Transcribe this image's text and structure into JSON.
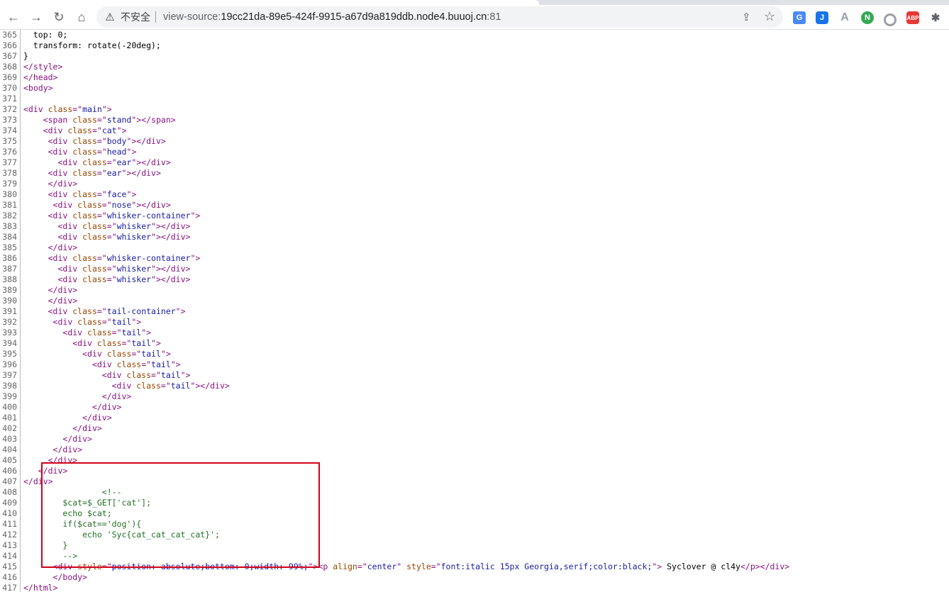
{
  "browser": {
    "security_label": "不安全",
    "url_scheme": "view-source:",
    "url_host": "19cc21da-89e5-424f-9915-a67d9a819ddb.node4.buuoj.cn",
    "url_port": ":81",
    "icons": {
      "back": "arrow-left-icon",
      "forward": "arrow-right-icon",
      "reload": "reload-icon",
      "home": "home-icon",
      "warning": "warning-icon",
      "share": "share-icon",
      "bookmark": "star-icon"
    },
    "extensions": [
      {
        "name": "translate-extension-icon",
        "glyph": "G"
      },
      {
        "name": "j-extension-icon",
        "glyph": "J"
      },
      {
        "name": "a-extension-icon",
        "glyph": "A"
      },
      {
        "name": "n-extension-icon",
        "glyph": "N"
      },
      {
        "name": "circle-extension-icon",
        "glyph": ""
      },
      {
        "name": "abp-extension-icon",
        "glyph": "ABP"
      },
      {
        "name": "puzzle-extension-icon",
        "glyph": "✱"
      }
    ]
  },
  "highlight_color": "#d0021b",
  "source_lines": [
    {
      "n": "365",
      "t": [
        [
          "txt",
          "  top: 0;"
        ]
      ]
    },
    {
      "n": "366",
      "t": [
        [
          "txt",
          "  transform: rotate(-20deg);"
        ]
      ]
    },
    {
      "n": "367",
      "t": [
        [
          "txt",
          "}"
        ]
      ]
    },
    {
      "n": "368",
      "t": [
        [
          "tag",
          "</style>"
        ]
      ]
    },
    {
      "n": "369",
      "t": [
        [
          "tag",
          "</head>"
        ]
      ]
    },
    {
      "n": "370",
      "t": [
        [
          "tag",
          "<body>"
        ]
      ]
    },
    {
      "n": "371",
      "t": []
    },
    {
      "n": "372",
      "t": [
        [
          "tag",
          "<div "
        ],
        [
          "attr",
          "class"
        ],
        [
          "tag",
          "=\""
        ],
        [
          "val",
          "main"
        ],
        [
          "tag",
          "\">"
        ]
      ]
    },
    {
      "n": "373",
      "t": [
        [
          "txt",
          "    "
        ],
        [
          "tag",
          "<span "
        ],
        [
          "attr",
          "class"
        ],
        [
          "tag",
          "=\""
        ],
        [
          "val",
          "stand"
        ],
        [
          "tag",
          "\"></span>"
        ]
      ]
    },
    {
      "n": "374",
      "t": [
        [
          "txt",
          "    "
        ],
        [
          "tag",
          "<div "
        ],
        [
          "attr",
          "class"
        ],
        [
          "tag",
          "=\""
        ],
        [
          "val",
          "cat"
        ],
        [
          "tag",
          "\">"
        ]
      ]
    },
    {
      "n": "375",
      "t": [
        [
          "txt",
          "     "
        ],
        [
          "tag",
          "<div "
        ],
        [
          "attr",
          "class"
        ],
        [
          "tag",
          "=\""
        ],
        [
          "val",
          "body"
        ],
        [
          "tag",
          "\"></div>"
        ]
      ]
    },
    {
      "n": "376",
      "t": [
        [
          "txt",
          "     "
        ],
        [
          "tag",
          "<div "
        ],
        [
          "attr",
          "class"
        ],
        [
          "tag",
          "=\""
        ],
        [
          "val",
          "head"
        ],
        [
          "tag",
          "\">"
        ]
      ]
    },
    {
      "n": "377",
      "t": [
        [
          "txt",
          "       "
        ],
        [
          "tag",
          "<div "
        ],
        [
          "attr",
          "class"
        ],
        [
          "tag",
          "=\""
        ],
        [
          "val",
          "ear"
        ],
        [
          "tag",
          "\"></div>"
        ]
      ]
    },
    {
      "n": "378",
      "t": [
        [
          "txt",
          "     "
        ],
        [
          "tag",
          "<div "
        ],
        [
          "attr",
          "class"
        ],
        [
          "tag",
          "=\""
        ],
        [
          "val",
          "ear"
        ],
        [
          "tag",
          "\"></div>"
        ]
      ]
    },
    {
      "n": "379",
      "t": [
        [
          "txt",
          "     "
        ],
        [
          "tag",
          "</div>"
        ]
      ]
    },
    {
      "n": "380",
      "t": [
        [
          "txt",
          "     "
        ],
        [
          "tag",
          "<div "
        ],
        [
          "attr",
          "class"
        ],
        [
          "tag",
          "=\""
        ],
        [
          "val",
          "face"
        ],
        [
          "tag",
          "\">"
        ]
      ]
    },
    {
      "n": "381",
      "t": [
        [
          "txt",
          "      "
        ],
        [
          "tag",
          "<div "
        ],
        [
          "attr",
          "class"
        ],
        [
          "tag",
          "=\""
        ],
        [
          "val",
          "nose"
        ],
        [
          "tag",
          "\"></div>"
        ]
      ]
    },
    {
      "n": "382",
      "t": [
        [
          "txt",
          "     "
        ],
        [
          "tag",
          "<div "
        ],
        [
          "attr",
          "class"
        ],
        [
          "tag",
          "=\""
        ],
        [
          "val",
          "whisker-container"
        ],
        [
          "tag",
          "\">"
        ]
      ]
    },
    {
      "n": "383",
      "t": [
        [
          "txt",
          "       "
        ],
        [
          "tag",
          "<div "
        ],
        [
          "attr",
          "class"
        ],
        [
          "tag",
          "=\""
        ],
        [
          "val",
          "whisker"
        ],
        [
          "tag",
          "\"></div>"
        ]
      ]
    },
    {
      "n": "384",
      "t": [
        [
          "txt",
          "       "
        ],
        [
          "tag",
          "<div "
        ],
        [
          "attr",
          "class"
        ],
        [
          "tag",
          "=\""
        ],
        [
          "val",
          "whisker"
        ],
        [
          "tag",
          "\"></div>"
        ]
      ]
    },
    {
      "n": "385",
      "t": [
        [
          "txt",
          "     "
        ],
        [
          "tag",
          "</div>"
        ]
      ]
    },
    {
      "n": "386",
      "t": [
        [
          "txt",
          "     "
        ],
        [
          "tag",
          "<div "
        ],
        [
          "attr",
          "class"
        ],
        [
          "tag",
          "=\""
        ],
        [
          "val",
          "whisker-container"
        ],
        [
          "tag",
          "\">"
        ]
      ]
    },
    {
      "n": "387",
      "t": [
        [
          "txt",
          "       "
        ],
        [
          "tag",
          "<div "
        ],
        [
          "attr",
          "class"
        ],
        [
          "tag",
          "=\""
        ],
        [
          "val",
          "whisker"
        ],
        [
          "tag",
          "\"></div>"
        ]
      ]
    },
    {
      "n": "388",
      "t": [
        [
          "txt",
          "       "
        ],
        [
          "tag",
          "<div "
        ],
        [
          "attr",
          "class"
        ],
        [
          "tag",
          "=\""
        ],
        [
          "val",
          "whisker"
        ],
        [
          "tag",
          "\"></div>"
        ]
      ]
    },
    {
      "n": "389",
      "t": [
        [
          "txt",
          "     "
        ],
        [
          "tag",
          "</div>"
        ]
      ]
    },
    {
      "n": "390",
      "t": [
        [
          "txt",
          "     "
        ],
        [
          "tag",
          "</div>"
        ]
      ]
    },
    {
      "n": "391",
      "t": [
        [
          "txt",
          "     "
        ],
        [
          "tag",
          "<div "
        ],
        [
          "attr",
          "class"
        ],
        [
          "tag",
          "=\""
        ],
        [
          "val",
          "tail-container"
        ],
        [
          "tag",
          "\">"
        ]
      ]
    },
    {
      "n": "392",
      "t": [
        [
          "txt",
          "      "
        ],
        [
          "tag",
          "<div "
        ],
        [
          "attr",
          "class"
        ],
        [
          "tag",
          "=\""
        ],
        [
          "val",
          "tail"
        ],
        [
          "tag",
          "\">"
        ]
      ]
    },
    {
      "n": "393",
      "t": [
        [
          "txt",
          "        "
        ],
        [
          "tag",
          "<div "
        ],
        [
          "attr",
          "class"
        ],
        [
          "tag",
          "=\""
        ],
        [
          "val",
          "tail"
        ],
        [
          "tag",
          "\">"
        ]
      ]
    },
    {
      "n": "394",
      "t": [
        [
          "txt",
          "          "
        ],
        [
          "tag",
          "<div "
        ],
        [
          "attr",
          "class"
        ],
        [
          "tag",
          "=\""
        ],
        [
          "val",
          "tail"
        ],
        [
          "tag",
          "\">"
        ]
      ]
    },
    {
      "n": "395",
      "t": [
        [
          "txt",
          "            "
        ],
        [
          "tag",
          "<div "
        ],
        [
          "attr",
          "class"
        ],
        [
          "tag",
          "=\""
        ],
        [
          "val",
          "tail"
        ],
        [
          "tag",
          "\">"
        ]
      ]
    },
    {
      "n": "396",
      "t": [
        [
          "txt",
          "              "
        ],
        [
          "tag",
          "<div "
        ],
        [
          "attr",
          "class"
        ],
        [
          "tag",
          "=\""
        ],
        [
          "val",
          "tail"
        ],
        [
          "tag",
          "\">"
        ]
      ]
    },
    {
      "n": "397",
      "t": [
        [
          "txt",
          "                "
        ],
        [
          "tag",
          "<div "
        ],
        [
          "attr",
          "class"
        ],
        [
          "tag",
          "=\""
        ],
        [
          "val",
          "tail"
        ],
        [
          "tag",
          "\">"
        ]
      ]
    },
    {
      "n": "398",
      "t": [
        [
          "txt",
          "                  "
        ],
        [
          "tag",
          "<div "
        ],
        [
          "attr",
          "class"
        ],
        [
          "tag",
          "=\""
        ],
        [
          "val",
          "tail"
        ],
        [
          "tag",
          "\"></div>"
        ]
      ]
    },
    {
      "n": "399",
      "t": [
        [
          "txt",
          "                "
        ],
        [
          "tag",
          "</div>"
        ]
      ]
    },
    {
      "n": "400",
      "t": [
        [
          "txt",
          "              "
        ],
        [
          "tag",
          "</div>"
        ]
      ]
    },
    {
      "n": "401",
      "t": [
        [
          "txt",
          "            "
        ],
        [
          "tag",
          "</div>"
        ]
      ]
    },
    {
      "n": "402",
      "t": [
        [
          "txt",
          "          "
        ],
        [
          "tag",
          "</div>"
        ]
      ]
    },
    {
      "n": "403",
      "t": [
        [
          "txt",
          "        "
        ],
        [
          "tag",
          "</div>"
        ]
      ]
    },
    {
      "n": "404",
      "t": [
        [
          "txt",
          "      "
        ],
        [
          "tag",
          "</div>"
        ]
      ]
    },
    {
      "n": "405",
      "t": [
        [
          "txt",
          "     "
        ],
        [
          "tag",
          "</div>"
        ]
      ]
    },
    {
      "n": "406",
      "t": [
        [
          "txt",
          "   "
        ],
        [
          "tag",
          "</div>"
        ]
      ]
    },
    {
      "n": "407",
      "t": [
        [
          "tag",
          "</div>"
        ]
      ]
    },
    {
      "n": "408",
      "t": [
        [
          "cmt",
          "                <!--"
        ]
      ]
    },
    {
      "n": "409",
      "t": [
        [
          "cmt",
          "        $cat=$_GET['cat'];"
        ]
      ]
    },
    {
      "n": "410",
      "t": [
        [
          "cmt",
          "        echo $cat;"
        ]
      ]
    },
    {
      "n": "411",
      "t": [
        [
          "cmt",
          "        if($cat=='dog'){"
        ]
      ]
    },
    {
      "n": "412",
      "t": [
        [
          "cmt",
          "            echo 'Syc{cat_cat_cat_cat}';"
        ]
      ]
    },
    {
      "n": "413",
      "t": [
        [
          "cmt",
          "        }"
        ]
      ]
    },
    {
      "n": "414",
      "t": [
        [
          "cmt",
          "        -->"
        ]
      ]
    },
    {
      "n": "415",
      "t": [
        [
          "txt",
          "      "
        ],
        [
          "tag",
          "<div "
        ],
        [
          "attr",
          "style"
        ],
        [
          "tag",
          "=\""
        ],
        [
          "val",
          "position: absolute;bottom: 0;width: 99%;"
        ],
        [
          "tag",
          "\"><p "
        ],
        [
          "attr",
          "align"
        ],
        [
          "tag",
          "=\""
        ],
        [
          "val",
          "center"
        ],
        [
          "tag",
          "\" "
        ],
        [
          "attr",
          "style"
        ],
        [
          "tag",
          "=\""
        ],
        [
          "val",
          "font:italic 15px Georgia,serif;color:black;"
        ],
        [
          "tag",
          "\">"
        ],
        [
          "txt",
          " Syclover @ cl4y"
        ],
        [
          "tag",
          "</p></div>"
        ]
      ]
    },
    {
      "n": "416",
      "t": [
        [
          "txt",
          "      "
        ],
        [
          "tag",
          "</body>"
        ]
      ]
    },
    {
      "n": "417",
      "t": [
        [
          "tag",
          "</html>"
        ]
      ]
    }
  ]
}
